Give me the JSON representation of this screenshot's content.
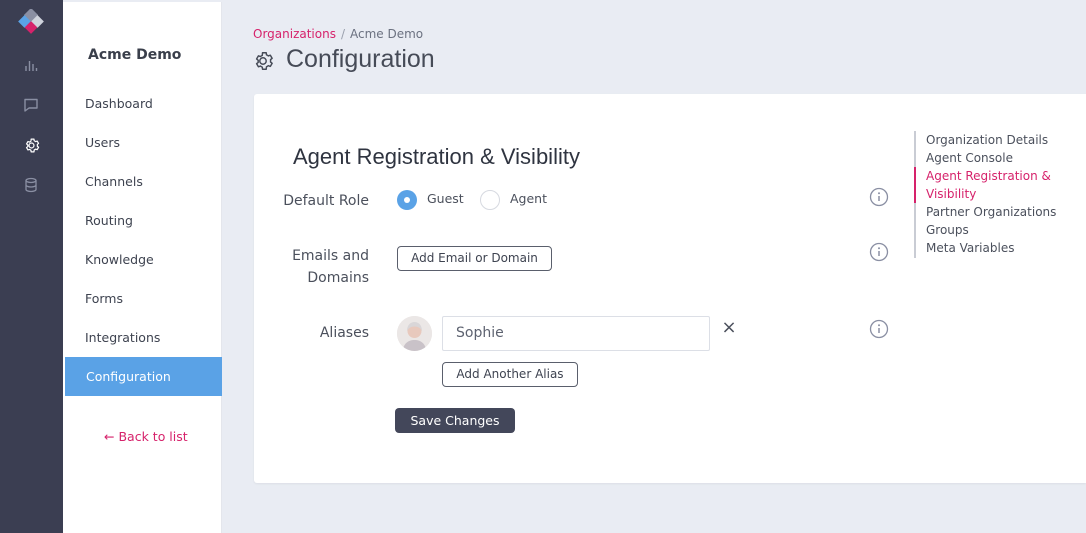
{
  "colors": {
    "accent": "#d6226b",
    "primary": "#5aa2e6",
    "rail": "#3b3e52",
    "save_button": "#43475a"
  },
  "rail": {
    "icons": [
      "app-logo-icon",
      "analytics-icon",
      "chat-icon",
      "settings-icon",
      "database-icon"
    ]
  },
  "sidebar": {
    "org_name": "Acme Demo",
    "items": [
      {
        "label": "Dashboard"
      },
      {
        "label": "Users"
      },
      {
        "label": "Channels"
      },
      {
        "label": "Routing"
      },
      {
        "label": "Knowledge"
      },
      {
        "label": "Forms"
      },
      {
        "label": "Integrations"
      },
      {
        "label": "Configuration",
        "active": true
      }
    ],
    "back_link": "Back to list"
  },
  "header": {
    "breadcrumb": {
      "parent": "Organizations",
      "separator": "/",
      "current": "Acme Demo"
    },
    "title": "Configuration"
  },
  "section": {
    "title": "Agent Registration & Visibility",
    "default_role": {
      "label": "Default Role",
      "options": [
        {
          "label": "Guest",
          "selected": true
        },
        {
          "label": "Agent",
          "selected": false
        }
      ]
    },
    "emails": {
      "label_line1": "Emails and",
      "label_line2": "Domains",
      "add_button": "Add Email or Domain"
    },
    "aliases": {
      "label": "Aliases",
      "value": "Sophie",
      "add_button": "Add Another Alias"
    },
    "save_button": "Save Changes"
  },
  "subnav": {
    "items": [
      {
        "label": "Organization Details"
      },
      {
        "label": "Agent Console"
      },
      {
        "label": "Agent Registration &",
        "active": true
      },
      {
        "label": "Visibility",
        "active": true
      },
      {
        "label": "Partner Organizations"
      },
      {
        "label": "Groups"
      },
      {
        "label": "Meta Variables"
      }
    ]
  }
}
